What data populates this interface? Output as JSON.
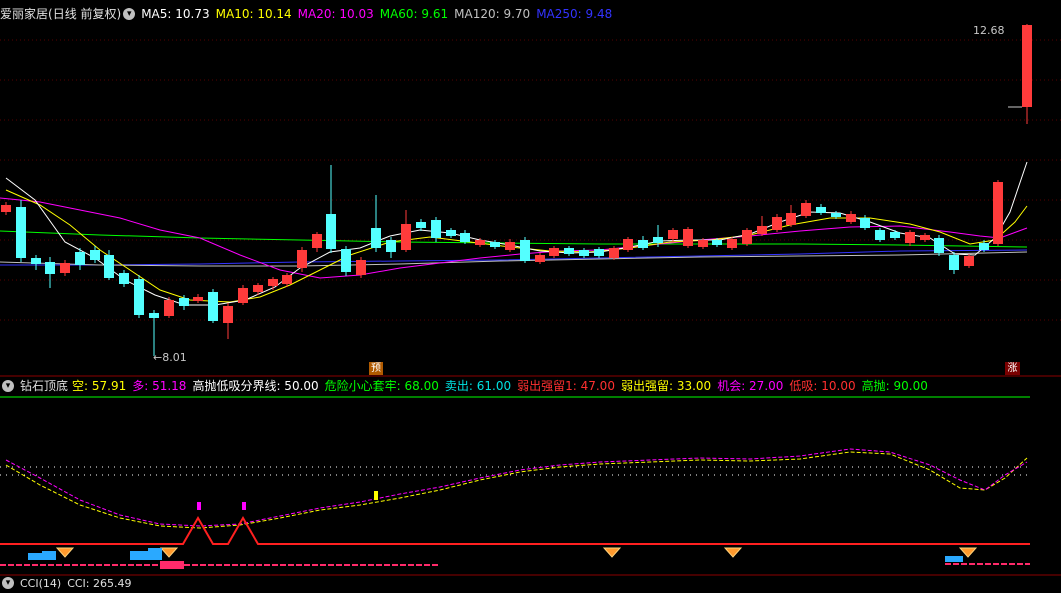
{
  "header": {
    "title": "爱丽家居",
    "mode": "(日线 前复权)",
    "ma": [
      {
        "label": "MA5: 10.73",
        "color": "#ffffff"
      },
      {
        "label": "MA10: 10.14",
        "color": "#ffff00"
      },
      {
        "label": "MA20: 10.03",
        "color": "#ff00ff"
      },
      {
        "label": "MA60: 9.61",
        "color": "#00ff00"
      },
      {
        "label": "MA120: 9.70",
        "color": "#c0c0c0"
      },
      {
        "label": "MA250: 9.48",
        "color": "#3333ff"
      }
    ]
  },
  "price_labels": {
    "high": "12.68",
    "low": "8.01"
  },
  "badges": {
    "pre": "预",
    "up": "涨"
  },
  "indicator": {
    "name": "钻石顶底",
    "params": [
      {
        "label": "空: 57.91",
        "color": "#ffff00"
      },
      {
        "label": "多: 51.18",
        "color": "#ff00ff"
      },
      {
        "label": "高抛低吸分界线: 50.00",
        "color": "#ffffff"
      },
      {
        "label": "危险小心套牢: 68.00",
        "color": "#00ff00"
      },
      {
        "label": "卖出: 61.00",
        "color": "#00e0e0"
      },
      {
        "label": "弱出强留1: 47.00",
        "color": "#ff3030"
      },
      {
        "label": "弱出强留: 33.00",
        "color": "#ffff00"
      },
      {
        "label": "机会: 27.00",
        "color": "#ff00ff"
      },
      {
        "label": "低吸: 10.00",
        "color": "#ff3030"
      },
      {
        "label": "高抛: 90.00",
        "color": "#00ff00"
      }
    ]
  },
  "cci": {
    "name": "CCI(14)",
    "value": "CCI: 265.49"
  },
  "colors": {
    "up": "#ff3b3b",
    "down": "#54ffff",
    "grid": "#8b0000"
  }
}
